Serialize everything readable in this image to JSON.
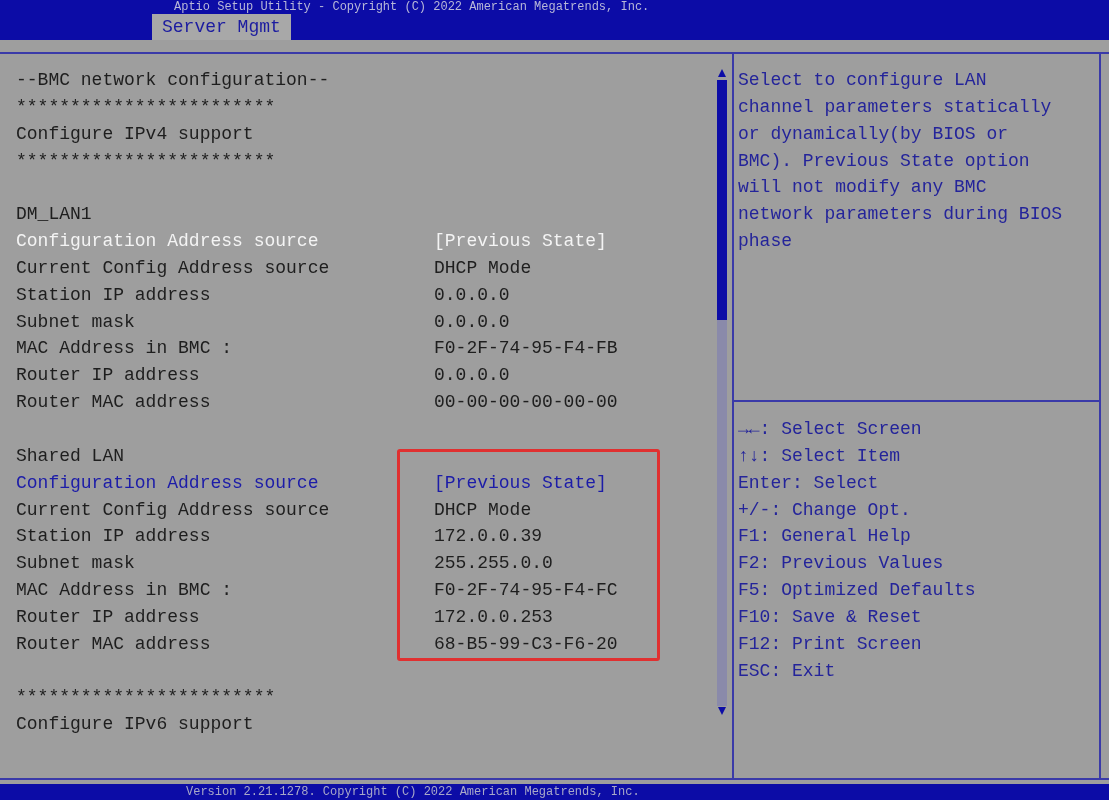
{
  "header": {
    "title": "Aptio Setup Utility - Copyright (C) 2022 American Megatrends, Inc.",
    "tabs": [
      {
        "label": "Server Mgmt",
        "selected": true
      }
    ]
  },
  "items": [
    {
      "kind": "text",
      "label": "--BMC network configuration--"
    },
    {
      "kind": "text",
      "label": "************************"
    },
    {
      "kind": "text",
      "label": "Configure IPv4 support"
    },
    {
      "kind": "text",
      "label": "************************"
    },
    {
      "kind": "blank"
    },
    {
      "kind": "text",
      "label": "DM_LAN1"
    },
    {
      "kind": "setting",
      "label": "Configuration Address source",
      "value": "[Previous State]",
      "selected": true
    },
    {
      "kind": "info",
      "label": "Current Config Address source",
      "value": "DHCP Mode"
    },
    {
      "kind": "info",
      "label": "Station IP address",
      "value": "0.0.0.0"
    },
    {
      "kind": "info",
      "label": "Subnet mask",
      "value": "0.0.0.0"
    },
    {
      "kind": "info",
      "label": "MAC Address in BMC :",
      "value": "F0-2F-74-95-F4-FB"
    },
    {
      "kind": "info",
      "label": "Router IP address",
      "value": "0.0.0.0"
    },
    {
      "kind": "info",
      "label": "Router MAC address",
      "value": "00-00-00-00-00-00"
    },
    {
      "kind": "blank"
    },
    {
      "kind": "text",
      "label": "Shared LAN"
    },
    {
      "kind": "setting",
      "label": "Configuration Address source",
      "value": "[Previous State]",
      "selected": false
    },
    {
      "kind": "info",
      "label": "Current Config Address source",
      "value": "DHCP Mode"
    },
    {
      "kind": "info",
      "label": "Station IP address",
      "value": "172.0.0.39"
    },
    {
      "kind": "info",
      "label": "Subnet mask",
      "value": "255.255.0.0"
    },
    {
      "kind": "info",
      "label": "MAC Address in BMC :",
      "value": "F0-2F-74-95-F4-FC"
    },
    {
      "kind": "info",
      "label": "Router IP address",
      "value": "172.0.0.253"
    },
    {
      "kind": "info",
      "label": "Router MAC address",
      "value": "68-B5-99-C3-F6-20"
    },
    {
      "kind": "blank"
    },
    {
      "kind": "text",
      "label": "************************"
    },
    {
      "kind": "text",
      "label": "Configure IPv6 support"
    }
  ],
  "help": {
    "lines": [
      "Select to configure LAN",
      "channel parameters statically",
      "or dynamically(by BIOS or",
      "BMC). Previous State option",
      "will not modify any BMC",
      "network parameters during BIOS",
      "phase"
    ]
  },
  "keys": [
    "→←: Select Screen",
    "↑↓: Select Item",
    "Enter: Select",
    "+/-: Change Opt.",
    "F1: General Help",
    "F2: Previous Values",
    "F5: Optimized Defaults",
    "F10: Save & Reset",
    "F12: Print Screen",
    "ESC: Exit"
  ],
  "footer": "Version 2.21.1278. Copyright (C) 2022 American Megatrends, Inc."
}
